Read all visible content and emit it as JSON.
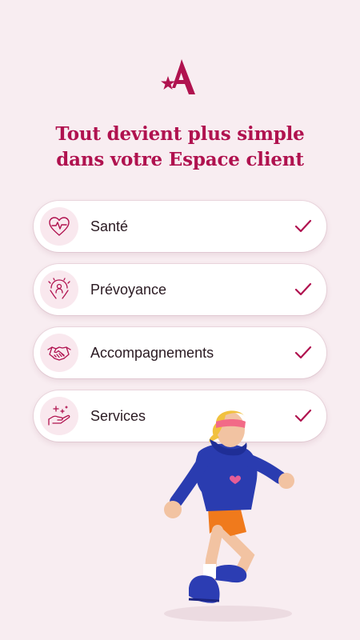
{
  "brand": {
    "accent": "#b0124f",
    "logo_icon": "star-a-logo"
  },
  "headline": {
    "line1": "Tout devient plus simple",
    "line2": "dans votre Espace client"
  },
  "features": [
    {
      "label": "Santé",
      "icon": "heart-pulse-icon",
      "checked": true
    },
    {
      "label": "Prévoyance",
      "icon": "protection-hands-icon",
      "checked": true
    },
    {
      "label": "Accompagnements",
      "icon": "handshake-icon",
      "checked": true
    },
    {
      "label": "Services",
      "icon": "hand-sparkle-icon",
      "checked": true
    }
  ]
}
